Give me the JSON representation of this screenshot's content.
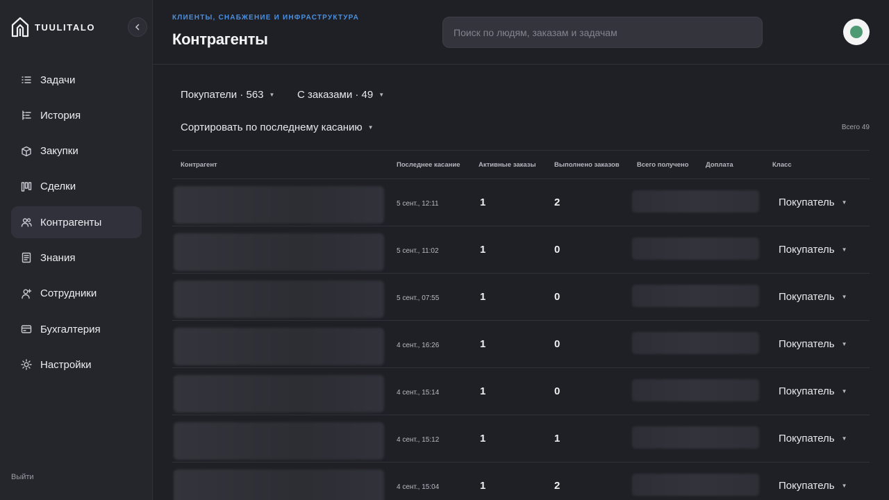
{
  "app": {
    "logo_text": "TUULITALO"
  },
  "sidebar": {
    "items": [
      {
        "label": "Задачи",
        "icon": "tasks-icon"
      },
      {
        "label": "История",
        "icon": "history-icon"
      },
      {
        "label": "Закупки",
        "icon": "box-icon"
      },
      {
        "label": "Сделки",
        "icon": "kanban-icon"
      },
      {
        "label": "Контрагенты",
        "icon": "users-icon",
        "active": true
      },
      {
        "label": "Знания",
        "icon": "document-icon"
      },
      {
        "label": "Сотрудники",
        "icon": "user-plus-icon"
      },
      {
        "label": "Бухгалтерия",
        "icon": "card-icon"
      },
      {
        "label": "Настройки",
        "icon": "sun-icon"
      }
    ],
    "logout": "Выйти"
  },
  "header": {
    "breadcrumb": "КЛИЕНТЫ, СНАБЖЕНИЕ И ИНФРАСТРУКТУРА",
    "title": "Контрагенты",
    "search_placeholder": "Поиск по людям, заказам и задачам",
    "avatar_color": "#4e9a72"
  },
  "filters": {
    "buyers": "Покупатели · 563",
    "with_orders": "С заказами · 49",
    "sort": "Сортировать по последнему касанию",
    "total": "Всего 49"
  },
  "table": {
    "columns": [
      "Контрагент",
      "Последнее касание",
      "Активные заказы",
      "Выполнено заказов",
      "Всего получено",
      "Доплата",
      "Класс"
    ],
    "rows": [
      {
        "last_touch": "5 сент., 12:11",
        "active": "1",
        "done": "2",
        "class": "Покупатель"
      },
      {
        "last_touch": "5 сент., 11:02",
        "active": "1",
        "done": "0",
        "class": "Покупатель"
      },
      {
        "last_touch": "5 сент., 07:55",
        "active": "1",
        "done": "0",
        "class": "Покупатель"
      },
      {
        "last_touch": "4 сент., 16:26",
        "active": "1",
        "done": "0",
        "class": "Покупатель"
      },
      {
        "last_touch": "4 сент., 15:14",
        "active": "1",
        "done": "0",
        "class": "Покупатель"
      },
      {
        "last_touch": "4 сент., 15:12",
        "active": "1",
        "done": "1",
        "class": "Покупатель"
      },
      {
        "last_touch": "4 сент., 15:04",
        "active": "1",
        "done": "2",
        "class": "Покупатель"
      }
    ]
  },
  "colors": {
    "accent": "#4a8fe0",
    "background": "#1f2026",
    "sidebar": "#25262c"
  }
}
